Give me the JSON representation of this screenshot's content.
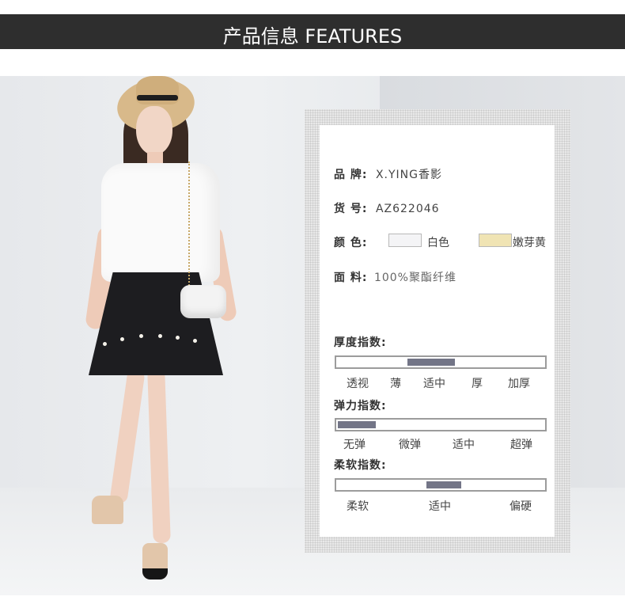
{
  "header": {
    "title": "产品信息 FEATURES"
  },
  "product": {
    "brand_label": "品 牌:",
    "brand_value": "X.YING香影",
    "sku_label": "货 号:",
    "sku_value": "AZ622046",
    "color_label": "颜 色:",
    "colors": [
      {
        "name": "白色",
        "swatch": "#f4f4f6"
      },
      {
        "name": "嫩芽黄",
        "swatch": "#f0e4b4"
      }
    ],
    "fabric_label": "面 料:",
    "fabric_value": "100%聚酯纤维"
  },
  "indices": [
    {
      "title": "厚度指数:",
      "ticks": [
        "透视",
        "薄",
        "适中",
        "厚",
        "加厚"
      ],
      "marker_start": 0.34,
      "marker_end": 0.57
    },
    {
      "title": "弹力指数:",
      "ticks": [
        "无弹",
        "微弹",
        "适中",
        "超弹"
      ],
      "marker_start": 0.0,
      "marker_end": 0.18
    },
    {
      "title": "柔软指数:",
      "ticks": [
        "柔软",
        "适中",
        "偏硬"
      ],
      "marker_start": 0.43,
      "marker_end": 0.6
    }
  ],
  "colors": {
    "header_bg": "#2e2e2e",
    "marker": "#737587"
  }
}
